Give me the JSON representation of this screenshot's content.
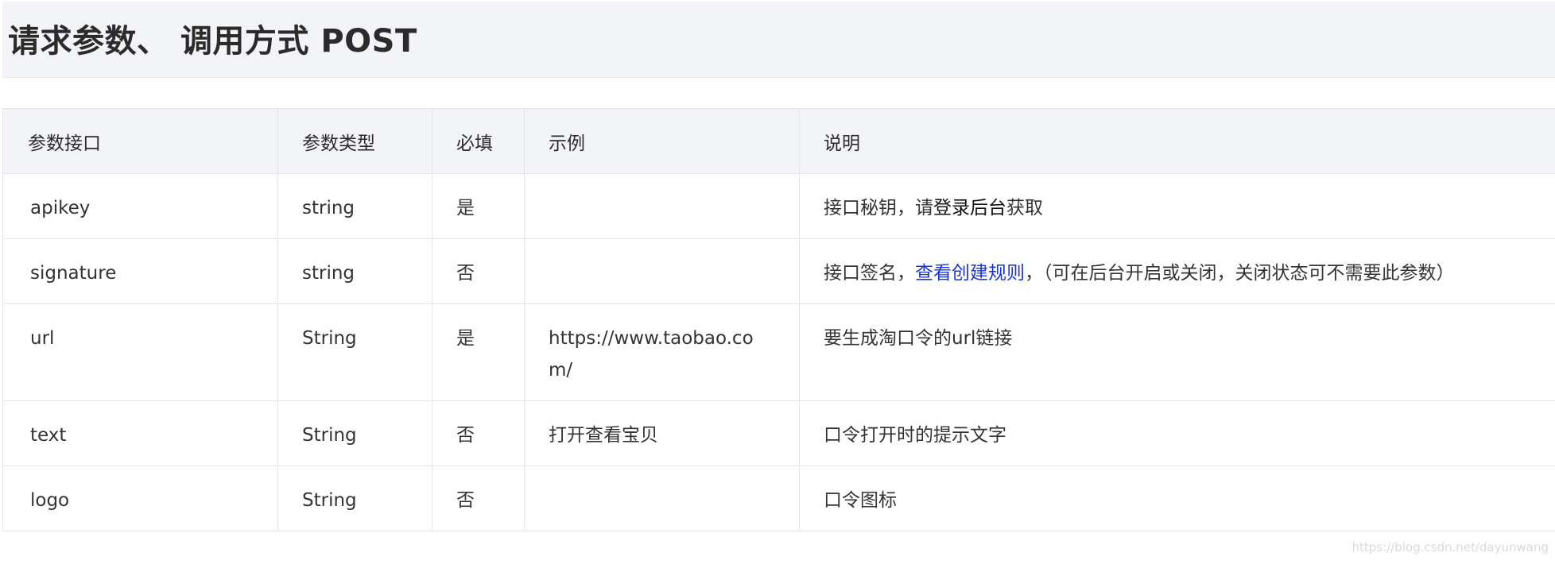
{
  "heading": {
    "title": "请求参数、 调用方式 POST"
  },
  "table": {
    "columns": [
      "参数接口",
      "参数类型",
      "必填",
      "示例",
      "说明"
    ],
    "rows": [
      {
        "name": "apikey",
        "type": "string",
        "required": "是",
        "example": "",
        "desc_prefix": "接口秘钥，请",
        "desc_strong": "登录后台",
        "desc_suffix": "获取"
      },
      {
        "name": "signature",
        "type": "string",
        "required": "否",
        "example": "",
        "desc_prefix": "接口签名，",
        "desc_link": "查看创建规则",
        "desc_suffix": "，（可在后台开启或关闭，关闭状态可不需要此参数）"
      },
      {
        "name": "url",
        "type": "String",
        "required": "是",
        "example_line1": "https://www.taobao.co",
        "example_line2": "m/",
        "desc": "要生成淘口令的url链接"
      },
      {
        "name": "text",
        "type": "String",
        "required": "否",
        "example": "打开查看宝贝",
        "desc": "口令打开时的提示文字"
      },
      {
        "name": "logo",
        "type": "String",
        "required": "否",
        "example": "",
        "desc": "口令图标"
      }
    ]
  },
  "watermark": "https://blog.csdn.net/dayunwang",
  "colors": {
    "required_yes": "#d8262d",
    "link": "#1a35d8",
    "header_bg": "#f3f4f7"
  }
}
